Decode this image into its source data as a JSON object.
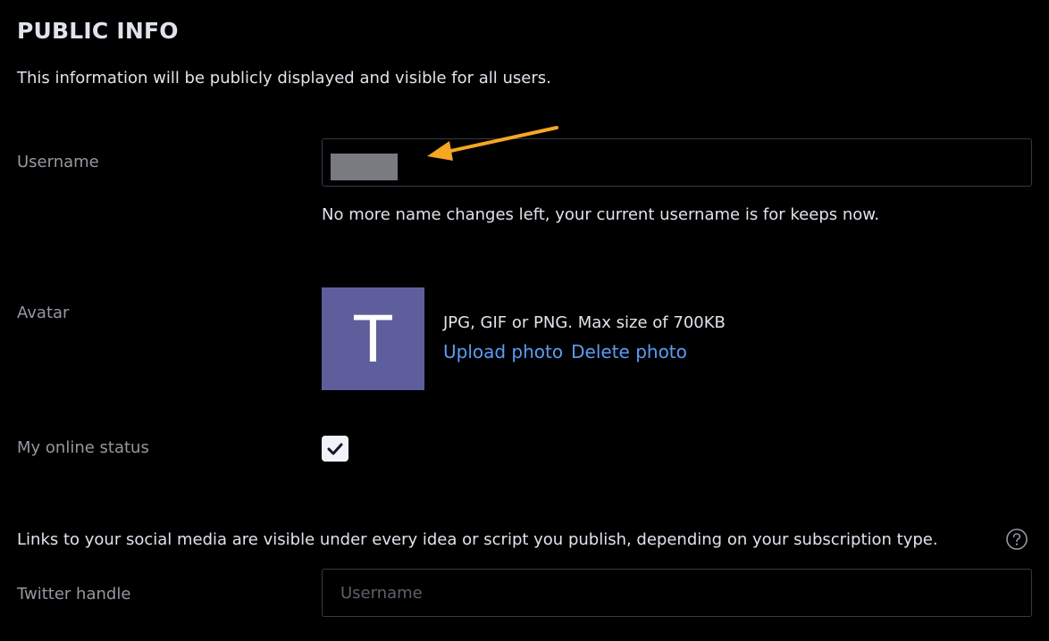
{
  "public_info": {
    "title": "PUBLIC INFO",
    "description": "This information will be publicly displayed and visible for all users."
  },
  "username": {
    "label": "Username",
    "value_redacted": true,
    "helper": "No more name changes left, your current username is for keeps now."
  },
  "avatar": {
    "label": "Avatar",
    "initial": "T",
    "info": "JPG, GIF or PNG. Max size of 700KB",
    "upload_label": "Upload photo",
    "delete_label": "Delete photo",
    "background_color": "#5f5e9c"
  },
  "online_status": {
    "label": "My online status",
    "checked": true
  },
  "social": {
    "note": "Links to your social media are visible under every idea or script you publish, depending on your subscription type.",
    "help_icon": "question-circle-icon",
    "twitter_label": "Twitter handle",
    "twitter_placeholder": "Username",
    "twitter_value": ""
  },
  "colors": {
    "background": "#000000",
    "link": "#5b9cf6",
    "annotation_arrow": "#f5a623"
  }
}
